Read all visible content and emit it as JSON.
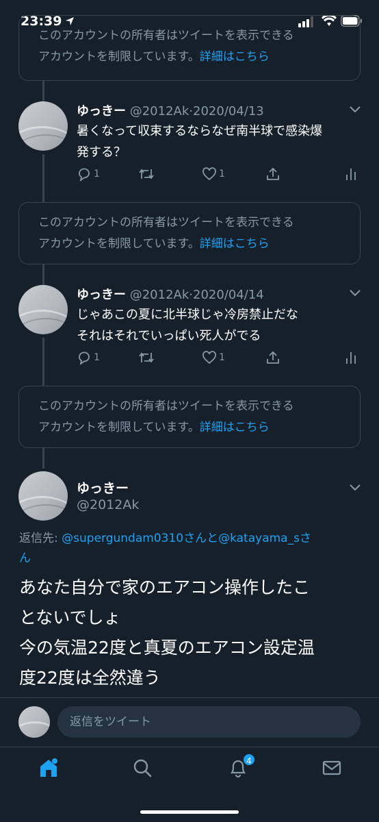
{
  "status_bar": {
    "time": "23:39"
  },
  "restricted": {
    "text_line1": "このアカウントの所有者はツイートを表示できる",
    "text_line2_prefix": "アカウントを制限しています。",
    "link": "詳細はこちら"
  },
  "tweets": [
    {
      "name": "ゆっきー",
      "handle": "@2012Ak",
      "separator": "·",
      "date": "2020/04/13",
      "lines": [
        "暑くなって収束するならなぜ南半球で感染爆",
        "発する？"
      ],
      "reply_count": "1",
      "retweet_count": "",
      "like_count": "1"
    },
    {
      "name": "ゆっきー",
      "handle": "@2012Ak",
      "separator": "·",
      "date": "2020/04/14",
      "lines": [
        "じゃあこの夏に北半球じゃ冷房禁止だな",
        "それはそれでいっぱい死人がでる"
      ],
      "reply_count": "1",
      "retweet_count": "",
      "like_count": "1"
    }
  ],
  "main_tweet": {
    "name": "ゆっきー",
    "handle": "@2012Ak",
    "reply_prefix": "返信先: ",
    "mention1": "@supergundam0310",
    "joiner": "さんと",
    "mention2": "@katayama_s",
    "suffix_line1": "さ",
    "suffix_line2": "ん",
    "lines": [
      "あなた自分で家のエアコン操作したこ",
      "とないでしょ",
      "今の気温22度と真夏のエアコン設定温",
      "度22度は全然違う"
    ]
  },
  "reply_bar": {
    "placeholder": "返信をツイート"
  },
  "tabbar": {
    "notification_badge": "4"
  },
  "colors": {
    "background": "#15202b",
    "accent": "#1da1f2",
    "border": "#38444d",
    "muted": "#8899a6"
  },
  "icons": [
    "location-arrow-icon",
    "signal-icon",
    "wifi-icon",
    "battery-icon",
    "chevron-down-icon",
    "reply-icon",
    "retweet-icon",
    "like-icon",
    "share-icon",
    "analytics-icon",
    "home-icon",
    "search-icon",
    "bell-icon",
    "mail-icon"
  ]
}
